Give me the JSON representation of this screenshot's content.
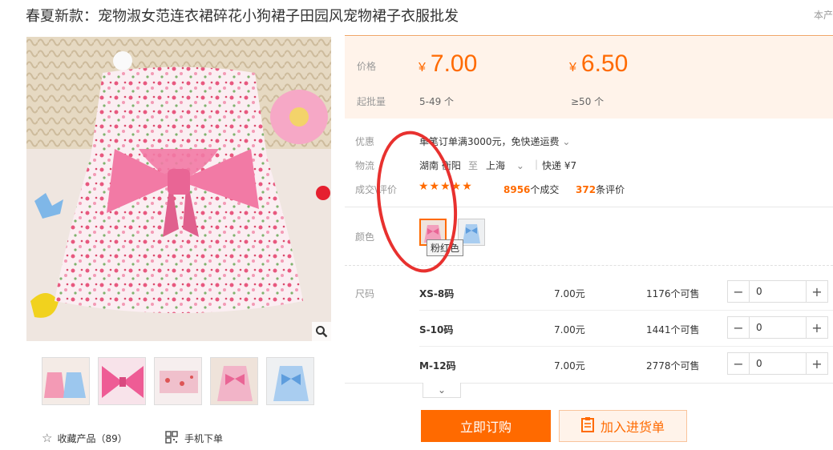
{
  "product": {
    "title": "春夏新款：宠物淑女范连衣裙碎花小狗裙子田园风宠物裙子衣服批发",
    "corner_text": "本产"
  },
  "price": {
    "price_label": "价格",
    "batch_label": "起批量",
    "tiers": [
      {
        "currency": "¥",
        "value": "7.00",
        "batch": "5-49 个"
      },
      {
        "currency": "¥",
        "value": "6.50",
        "batch": "≥50 个"
      }
    ]
  },
  "info": {
    "promo_label": "优惠",
    "promo_text": "单笔订单满3000元，免快递运费",
    "shipping_label": "物流",
    "ship_from": "湖南 衡阳",
    "ship_to_word": "至",
    "ship_to": "上海",
    "ship_method": "快递 ¥7",
    "review_label": "成交\\评价",
    "stars": "★★★★★",
    "deals_count": "8956",
    "deals_suffix": "个成交",
    "review_count": "372",
    "review_suffix": "条评价"
  },
  "color": {
    "label": "颜色",
    "tooltip": "粉红色"
  },
  "sizes": {
    "label": "尺码",
    "rows": [
      {
        "name": "XS-8码",
        "price": "7.00元",
        "stock": "1176个可售",
        "qty": "0"
      },
      {
        "name": "S-10码",
        "price": "7.00元",
        "stock": "1441个可售",
        "qty": "0"
      },
      {
        "name": "M-12码",
        "price": "7.00元",
        "stock": "2778个可售",
        "qty": "0"
      }
    ]
  },
  "actions": {
    "buy_label": "立即订购",
    "cart_label": "加入进货单",
    "favorite_label": "收藏产品（89）",
    "mobile_label": "手机下单"
  },
  "colors": {
    "accent": "#ff6a00",
    "price_bg": "#fff3ea",
    "annotation": "#e8312f",
    "dress_pink": "#f27aa5"
  }
}
